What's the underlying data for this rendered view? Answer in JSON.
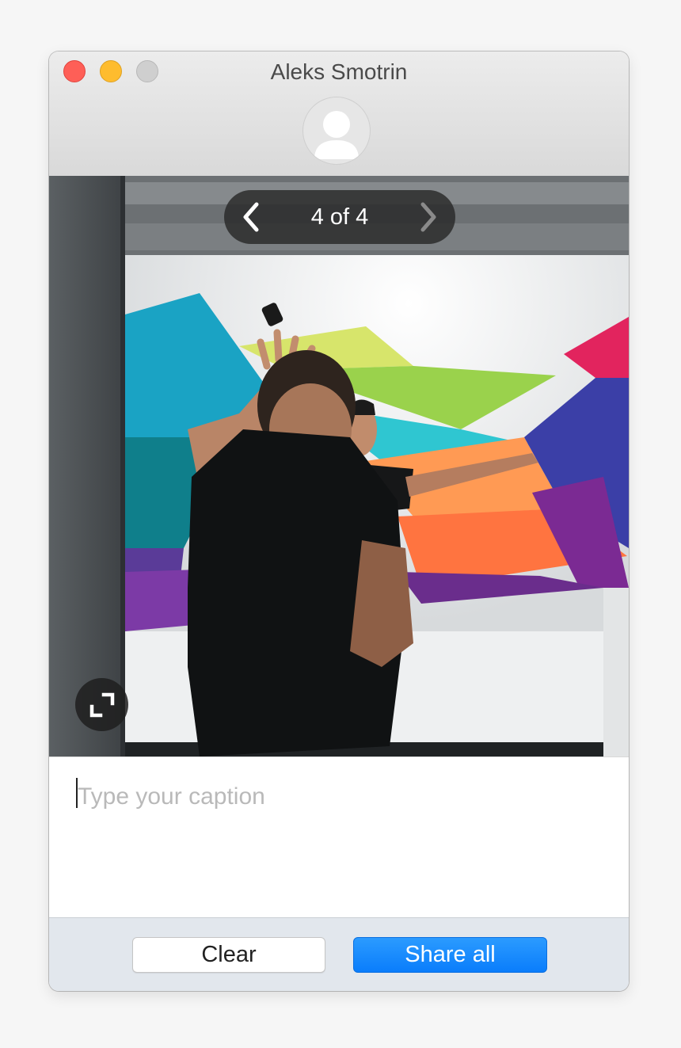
{
  "window": {
    "title": "Aleks Smotrin",
    "traffic_lights": {
      "close_color": "#fe5f57",
      "minimize_color": "#febc2e",
      "zoom_color": "#cfcfcf"
    },
    "avatar_icon": "person-silhouette-icon"
  },
  "viewer": {
    "pager_label": "4 of 4",
    "prev_icon": "chevron-left-icon",
    "next_icon": "chevron-right-icon",
    "expand_icon": "expand-icon"
  },
  "caption": {
    "placeholder": "Type your caption",
    "value": ""
  },
  "footer": {
    "clear_label": "Clear",
    "share_label": "Share all",
    "accent": "#0a7dfb"
  }
}
